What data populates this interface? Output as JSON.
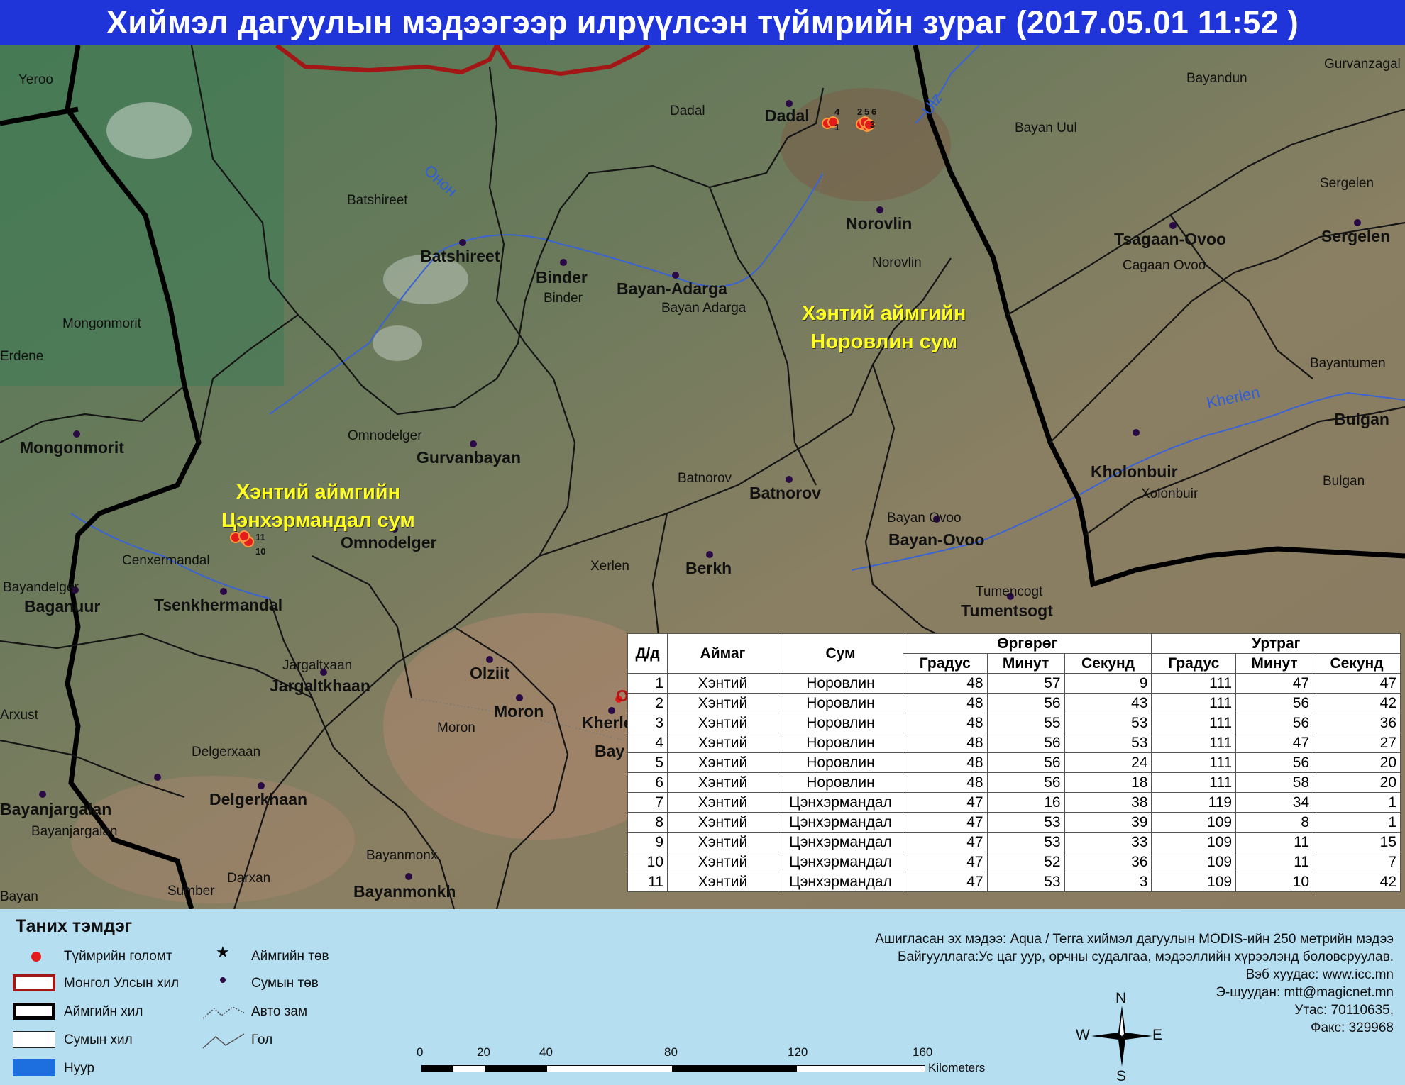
{
  "title": "Хиймэл дагуулын мэдээгээр илрүүлсэн түймрийн зураг  (2017.05.01 11:52 )",
  "map": {
    "rivers": {
      "onon": "Онон",
      "ulz": "Ulz",
      "kherlen": "Kherlen"
    },
    "highlights": [
      {
        "line1": "Хэнтий аймгийн",
        "line2": "Норовлин сум"
      },
      {
        "line1": "Хэнтий аймгийн",
        "line2": "Цэнхэрмандал сум"
      }
    ],
    "places_small": [
      "Yeroo",
      "Dadal",
      "Bayandun",
      "Gurvanzagal",
      "Bayan Uul",
      "Sergelen",
      "Batshireet",
      "Binder",
      "Bayan Adarga",
      "Norovlin",
      "Cagaan Ovoo",
      "Mongonmorit",
      "Erdene",
      "Bayantumen",
      "Omnodelger",
      "Batnorov",
      "Bulgan",
      "Xolonbuir",
      "Bayan Ovoo",
      "Cenxermandal",
      "Xerlen",
      "Tumencogt",
      "Bayandelger",
      "Jargaltxaan",
      "Arxust",
      "Moron",
      "Delgerxaan",
      "Bayanjargalan",
      "Bayanmonx",
      "Darxan",
      "Sumber",
      "Bayan"
    ],
    "places_large": [
      "Dadal",
      "Norovlin",
      "Tsagaan-Ovoo",
      "Sergelen",
      "Batshireet",
      "Binder",
      "Bayan-Adarga",
      "Mongonmorit",
      "Gurvanbayan",
      "Batnorov",
      "Bulgan",
      "Kholonbuir",
      "Omnodelger",
      "Bayan-Ovoo",
      "Berkh",
      "Tumentsogt",
      "Baganuur",
      "Tsenkhermandal",
      "Jargaltkhaan",
      "Olziit",
      "Moron",
      "Kherlen",
      "Bay",
      "Bayanjargalan",
      "Delgerkhaan",
      "Bayanmonkh"
    ],
    "red_labels": [
      "O"
    ],
    "fire_labels": [
      "4",
      "1",
      "2",
      "5",
      "6",
      "3",
      "11",
      "10"
    ]
  },
  "table": {
    "header_top": {
      "num": "Д/д",
      "aimag": "Аймаг",
      "sum": "Сум",
      "lat": "Өргөрөг",
      "lon": "Уртраг"
    },
    "header_sub": [
      "Градус",
      "Минут",
      "Секунд",
      "Градус",
      "Минут",
      "Секунд"
    ],
    "rows": [
      [
        "1",
        "Хэнтий",
        "Норовлин",
        "48",
        "57",
        "9",
        "111",
        "47",
        "47"
      ],
      [
        "2",
        "Хэнтий",
        "Норовлин",
        "48",
        "56",
        "43",
        "111",
        "56",
        "42"
      ],
      [
        "3",
        "Хэнтий",
        "Норовлин",
        "48",
        "55",
        "53",
        "111",
        "56",
        "36"
      ],
      [
        "4",
        "Хэнтий",
        "Норовлин",
        "48",
        "56",
        "53",
        "111",
        "47",
        "27"
      ],
      [
        "5",
        "Хэнтий",
        "Норовлин",
        "48",
        "56",
        "24",
        "111",
        "56",
        "20"
      ],
      [
        "6",
        "Хэнтий",
        "Норовлин",
        "48",
        "56",
        "18",
        "111",
        "58",
        "20"
      ],
      [
        "7",
        "Хэнтий",
        "Цэнхэрмандал",
        "47",
        "16",
        "38",
        "119",
        "34",
        "1"
      ],
      [
        "8",
        "Хэнтий",
        "Цэнхэрмандал",
        "47",
        "53",
        "39",
        "109",
        "8",
        "1"
      ],
      [
        "9",
        "Хэнтий",
        "Цэнхэрмандал",
        "47",
        "53",
        "33",
        "109",
        "11",
        "15"
      ],
      [
        "10",
        "Хэнтий",
        "Цэнхэрмандал",
        "47",
        "52",
        "36",
        "109",
        "11",
        "7"
      ],
      [
        "11",
        "Хэнтий",
        "Цэнхэрмандал",
        "47",
        "53",
        "3",
        "109",
        "10",
        "42"
      ]
    ]
  },
  "legend": {
    "title": "Таних тэмдэг",
    "items": {
      "fire": "Түймрийн голомт",
      "country": "Монгол Улсын хил",
      "aimag_border": "Аймгийн хил",
      "sum_border": "Сумын хил",
      "lake": "Нуур",
      "aimag_center": "Аймгийн төв",
      "sum_center": "Сумын төв",
      "road": "Авто зам",
      "river": "Гол"
    }
  },
  "scale": {
    "ticks": [
      "0",
      "20",
      "40",
      "80",
      "120",
      "160"
    ],
    "unit": "Kilometers"
  },
  "compass": {
    "n": "N",
    "s": "S",
    "e": "E",
    "w": "W"
  },
  "credits": [
    "Ашигласан эх мэдээ: Aqua / Terra хиймэл дагуулын MODIS-ийн 250 метрийн мэдээ",
    "Байгууллага:Ус цаг уур, орчны судалгаа, мэдээллийн хүрээлэнд боловсруулав.",
    "Вэб хуудас: www.icc.mn",
    "Э-шуудан: mtt@magicnet.mn",
    "Утас: 70110635,",
    "Факс: 329968"
  ],
  "colors": {
    "title_bg": "#1f34d9",
    "legend_bg": "#b6def1",
    "fire": "#e41b1b",
    "highlight_text": "#ffff22",
    "river": "#2e5dd9",
    "country_border": "#a31616"
  }
}
